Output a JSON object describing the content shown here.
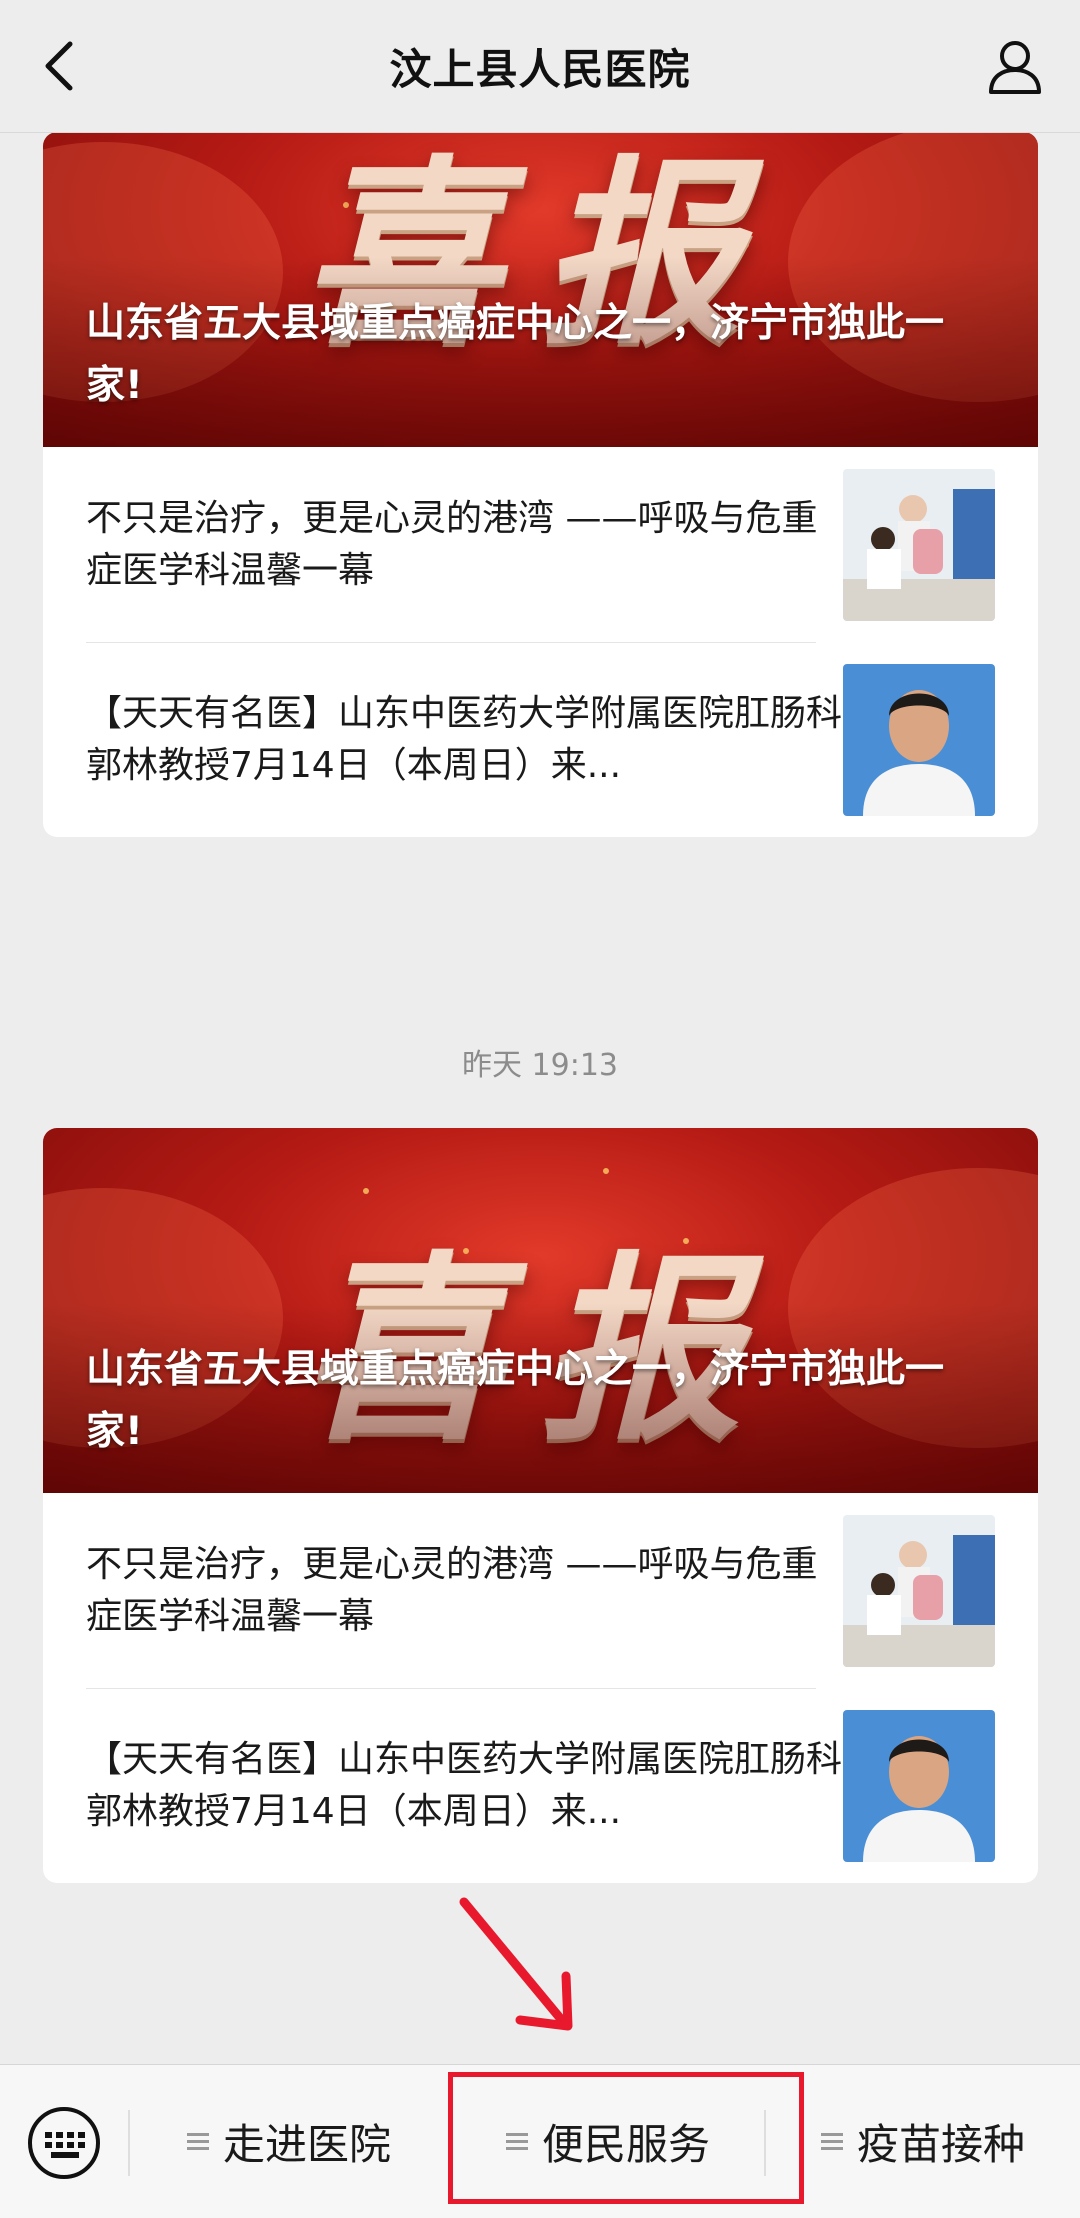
{
  "header": {
    "title": "汶上县人民医院",
    "back_icon": "chevron-left-icon",
    "profile_icon": "person-icon"
  },
  "feed": {
    "groups": [
      {
        "banner_text": "喜报",
        "banner_headline": "山东省五大县域重点癌症中心之一，济宁市独此一家!",
        "items": [
          {
            "title": "不只是治疗，更是心灵的港湾 ——呼吸与危重症医学科温馨一幕",
            "thumb": "nurse-child-photo"
          },
          {
            "title": "【天天有名医】山东中医药大学附属医院肛肠科郭林教授7月14日（本周日）来...",
            "thumb": "doctor-portrait-photo"
          }
        ]
      },
      {
        "timestamp": "昨天 19:13",
        "banner_text": "喜报",
        "banner_headline": "山东省五大县域重点癌症中心之一，济宁市独此一家!",
        "items": [
          {
            "title": "不只是治疗，更是心灵的港湾 ——呼吸与危重症医学科温馨一幕",
            "thumb": "nurse-child-photo"
          },
          {
            "title": "【天天有名医】山东中医药大学附属医院肛肠科郭林教授7月14日（本周日）来...",
            "thumb": "doctor-portrait-photo"
          }
        ]
      }
    ]
  },
  "bottom_menu": {
    "keyboard_icon": "keyboard-icon",
    "items": [
      {
        "label": "走进医院"
      },
      {
        "label": "便民服务"
      },
      {
        "label": "疫苗接种"
      }
    ],
    "highlight_color": "#e8192c"
  }
}
